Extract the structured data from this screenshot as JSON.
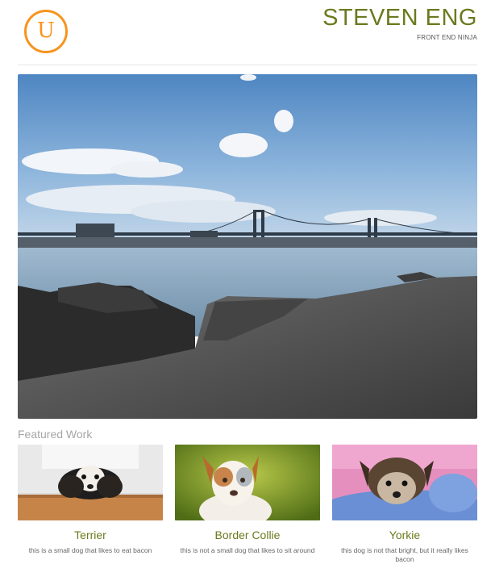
{
  "header": {
    "logo_letter": "U",
    "name": "STEVEN ENG",
    "tagline": "FRONT END NINJA"
  },
  "hero": {
    "image": "bridge-waterfront-photo"
  },
  "featured": {
    "title": "Featured Work",
    "items": [
      {
        "title": "Terrier",
        "description": "this is a small dog that likes to eat bacon",
        "image": "terrier-photo"
      },
      {
        "title": "Border Collie",
        "description": "this is not a small dog that likes to sit around",
        "image": "border-collie-photo"
      },
      {
        "title": "Yorkie",
        "description": "this dog is not that bright, but it really likes bacon",
        "image": "yorkie-photo"
      }
    ]
  },
  "colors": {
    "accent": "#f7941d",
    "title": "#6b7a1e",
    "muted": "#a6a6a6"
  }
}
